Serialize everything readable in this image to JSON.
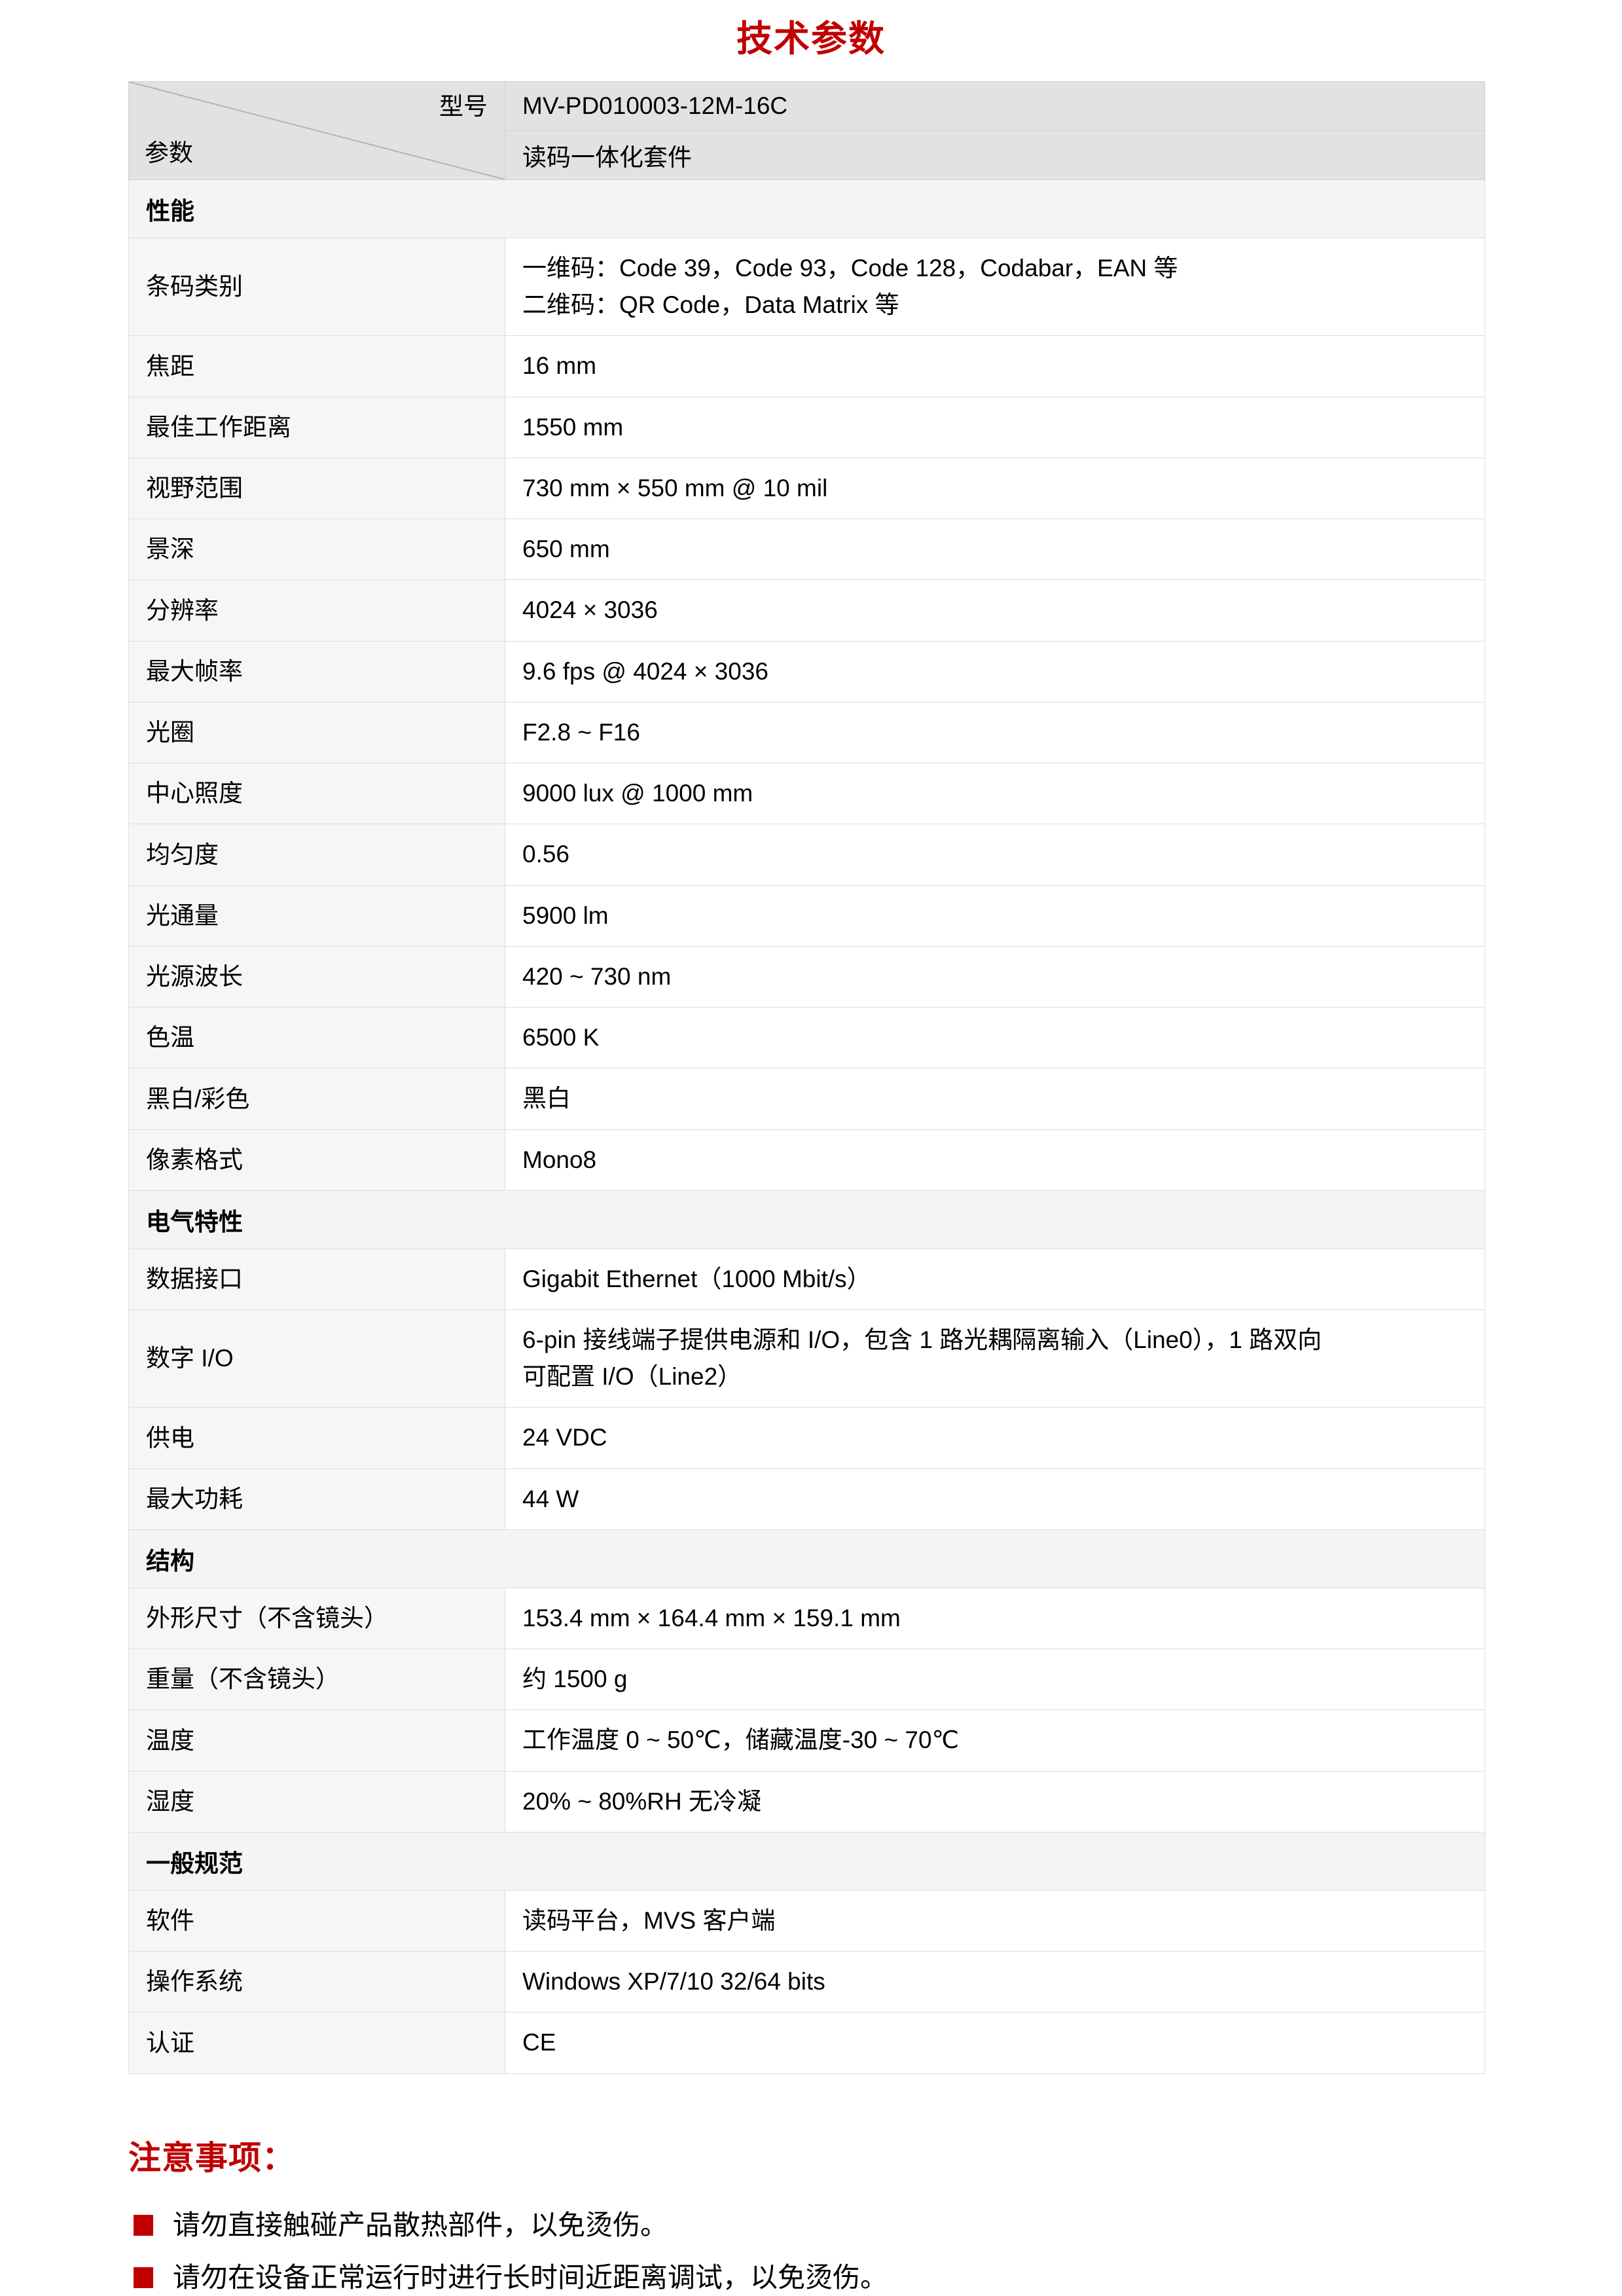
{
  "title": "技术参数",
  "table": {
    "header": {
      "corner_top_right": "型号",
      "corner_bottom_left": "参数",
      "model": "MV-PD010003-12M-16C",
      "product": "读码一体化套件"
    },
    "sections": [
      {
        "name": "性能",
        "rows": [
          {
            "label": "条码类别",
            "lines": [
              "一维码：Code 39，Code 93，Code 128，Codabar，EAN 等",
              "二维码：QR Code，Data Matrix 等"
            ]
          },
          {
            "label": "焦距",
            "lines": [
              "16 mm"
            ]
          },
          {
            "label": "最佳工作距离",
            "lines": [
              "1550 mm"
            ]
          },
          {
            "label": "视野范围",
            "lines": [
              "730 mm × 550 mm @ 10 mil"
            ]
          },
          {
            "label": "景深",
            "lines": [
              "650 mm"
            ]
          },
          {
            "label": "分辨率",
            "lines": [
              "4024 × 3036"
            ]
          },
          {
            "label": "最大帧率",
            "lines": [
              "9.6 fps @ 4024 × 3036"
            ]
          },
          {
            "label": "光圈",
            "lines": [
              "F2.8 ~ F16"
            ]
          },
          {
            "label": "中心照度",
            "lines": [
              "9000 lux @ 1000 mm"
            ]
          },
          {
            "label": "均匀度",
            "lines": [
              "0.56"
            ]
          },
          {
            "label": "光通量",
            "lines": [
              "5900 lm"
            ]
          },
          {
            "label": "光源波长",
            "lines": [
              "420 ~ 730 nm"
            ]
          },
          {
            "label": "色温",
            "lines": [
              "6500 K"
            ]
          },
          {
            "label": "黑白/彩色",
            "lines": [
              "黑白"
            ]
          },
          {
            "label": "像素格式",
            "lines": [
              "Mono8"
            ]
          }
        ]
      },
      {
        "name": "电气特性",
        "rows": [
          {
            "label": "数据接口",
            "lines": [
              "Gigabit Ethernet（1000 Mbit/s）"
            ]
          },
          {
            "label": "数字 I/O",
            "lines": [
              "6-pin 接线端子提供电源和 I/O，包含 1 路光耦隔离输入（Line0），1 路双向",
              "可配置 I/O（Line2）"
            ]
          },
          {
            "label": "供电",
            "lines": [
              "24 VDC"
            ]
          },
          {
            "label": "最大功耗",
            "lines": [
              "44 W"
            ]
          }
        ]
      },
      {
        "name": "结构",
        "rows": [
          {
            "label": "外形尺寸（不含镜头）",
            "lines": [
              "153.4 mm × 164.4 mm × 159.1 mm"
            ]
          },
          {
            "label": "重量（不含镜头）",
            "lines": [
              "约 1500 g"
            ]
          },
          {
            "label": "温度",
            "lines": [
              "工作温度 0 ~ 50℃，储藏温度-30 ~ 70℃"
            ]
          },
          {
            "label": "湿度",
            "lines": [
              "20% ~ 80%RH 无冷凝"
            ]
          }
        ]
      },
      {
        "name": "一般规范",
        "rows": [
          {
            "label": "软件",
            "lines": [
              "读码平台，MVS 客户端"
            ]
          },
          {
            "label": "操作系统",
            "lines": [
              "Windows XP/7/10 32/64 bits"
            ]
          },
          {
            "label": "认证",
            "lines": [
              "CE"
            ]
          }
        ]
      }
    ]
  },
  "notes": {
    "title": "注意事项：",
    "items": [
      "请勿直接触碰产品散热部件，以免烫伤。",
      "请勿在设备正常运行时进行长时间近距离调试，以免烫伤。"
    ]
  },
  "colors": {
    "accent_red": "#c00000",
    "header_bg": "#e2e2e2",
    "section_bg": "#f4f4f4",
    "label_bg": "#f6f6f6",
    "border": "#dedede"
  }
}
